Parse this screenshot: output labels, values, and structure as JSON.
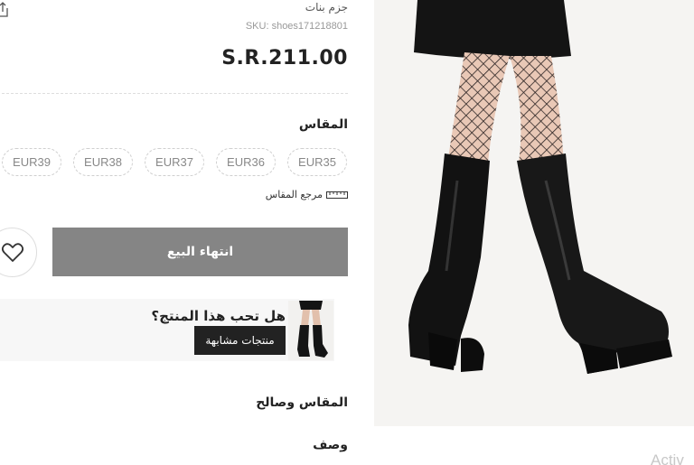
{
  "breadcrumb": {
    "text": "جزم بنات"
  },
  "product": {
    "sku": "SKU: shoes171218801",
    "price": "S.R.211.00",
    "image_alt": "knee-high black platform boots with fishnet tights"
  },
  "size": {
    "heading": "المقاس",
    "options": [
      "EUR35",
      "EUR36",
      "EUR37",
      "EUR38",
      "EUR39"
    ],
    "guide_label": "مرجع المقاس"
  },
  "actions": {
    "sold_out_label": "انتهاء البيع"
  },
  "similar": {
    "question": "هل تحب هذا المنتج؟",
    "button_label": "منتجات مشابهة"
  },
  "sections": {
    "fit_heading": "المقاس وصالح",
    "description_heading": "وصف"
  },
  "watermark": {
    "text": "Activ"
  },
  "colors": {
    "sold_out_bg": "#858585",
    "similar_btn_bg": "#222222",
    "image_bg": "#f5f4f2"
  },
  "icons": {
    "share": "share-icon",
    "ruler": "ruler-icon",
    "wishlist": "heart-icon"
  }
}
